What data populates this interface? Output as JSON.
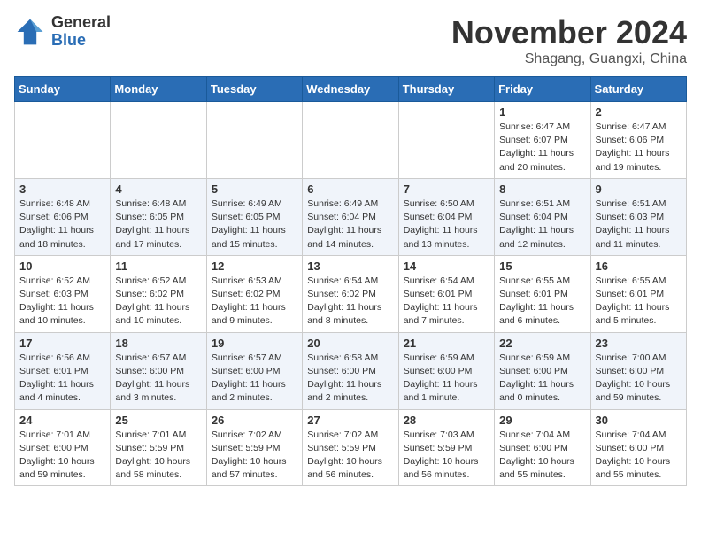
{
  "logo": {
    "general": "General",
    "blue": "Blue"
  },
  "header": {
    "month": "November 2024",
    "location": "Shagang, Guangxi, China"
  },
  "weekdays": [
    "Sunday",
    "Monday",
    "Tuesday",
    "Wednesday",
    "Thursday",
    "Friday",
    "Saturday"
  ],
  "weeks": [
    [
      {
        "day": "",
        "content": ""
      },
      {
        "day": "",
        "content": ""
      },
      {
        "day": "",
        "content": ""
      },
      {
        "day": "",
        "content": ""
      },
      {
        "day": "",
        "content": ""
      },
      {
        "day": "1",
        "content": "Sunrise: 6:47 AM\nSunset: 6:07 PM\nDaylight: 11 hours\nand 20 minutes."
      },
      {
        "day": "2",
        "content": "Sunrise: 6:47 AM\nSunset: 6:06 PM\nDaylight: 11 hours\nand 19 minutes."
      }
    ],
    [
      {
        "day": "3",
        "content": "Sunrise: 6:48 AM\nSunset: 6:06 PM\nDaylight: 11 hours\nand 18 minutes."
      },
      {
        "day": "4",
        "content": "Sunrise: 6:48 AM\nSunset: 6:05 PM\nDaylight: 11 hours\nand 17 minutes."
      },
      {
        "day": "5",
        "content": "Sunrise: 6:49 AM\nSunset: 6:05 PM\nDaylight: 11 hours\nand 15 minutes."
      },
      {
        "day": "6",
        "content": "Sunrise: 6:49 AM\nSunset: 6:04 PM\nDaylight: 11 hours\nand 14 minutes."
      },
      {
        "day": "7",
        "content": "Sunrise: 6:50 AM\nSunset: 6:04 PM\nDaylight: 11 hours\nand 13 minutes."
      },
      {
        "day": "8",
        "content": "Sunrise: 6:51 AM\nSunset: 6:04 PM\nDaylight: 11 hours\nand 12 minutes."
      },
      {
        "day": "9",
        "content": "Sunrise: 6:51 AM\nSunset: 6:03 PM\nDaylight: 11 hours\nand 11 minutes."
      }
    ],
    [
      {
        "day": "10",
        "content": "Sunrise: 6:52 AM\nSunset: 6:03 PM\nDaylight: 11 hours\nand 10 minutes."
      },
      {
        "day": "11",
        "content": "Sunrise: 6:52 AM\nSunset: 6:02 PM\nDaylight: 11 hours\nand 10 minutes."
      },
      {
        "day": "12",
        "content": "Sunrise: 6:53 AM\nSunset: 6:02 PM\nDaylight: 11 hours\nand 9 minutes."
      },
      {
        "day": "13",
        "content": "Sunrise: 6:54 AM\nSunset: 6:02 PM\nDaylight: 11 hours\nand 8 minutes."
      },
      {
        "day": "14",
        "content": "Sunrise: 6:54 AM\nSunset: 6:01 PM\nDaylight: 11 hours\nand 7 minutes."
      },
      {
        "day": "15",
        "content": "Sunrise: 6:55 AM\nSunset: 6:01 PM\nDaylight: 11 hours\nand 6 minutes."
      },
      {
        "day": "16",
        "content": "Sunrise: 6:55 AM\nSunset: 6:01 PM\nDaylight: 11 hours\nand 5 minutes."
      }
    ],
    [
      {
        "day": "17",
        "content": "Sunrise: 6:56 AM\nSunset: 6:01 PM\nDaylight: 11 hours\nand 4 minutes."
      },
      {
        "day": "18",
        "content": "Sunrise: 6:57 AM\nSunset: 6:00 PM\nDaylight: 11 hours\nand 3 minutes."
      },
      {
        "day": "19",
        "content": "Sunrise: 6:57 AM\nSunset: 6:00 PM\nDaylight: 11 hours\nand 2 minutes."
      },
      {
        "day": "20",
        "content": "Sunrise: 6:58 AM\nSunset: 6:00 PM\nDaylight: 11 hours\nand 2 minutes."
      },
      {
        "day": "21",
        "content": "Sunrise: 6:59 AM\nSunset: 6:00 PM\nDaylight: 11 hours\nand 1 minute."
      },
      {
        "day": "22",
        "content": "Sunrise: 6:59 AM\nSunset: 6:00 PM\nDaylight: 11 hours\nand 0 minutes."
      },
      {
        "day": "23",
        "content": "Sunrise: 7:00 AM\nSunset: 6:00 PM\nDaylight: 10 hours\nand 59 minutes."
      }
    ],
    [
      {
        "day": "24",
        "content": "Sunrise: 7:01 AM\nSunset: 6:00 PM\nDaylight: 10 hours\nand 59 minutes."
      },
      {
        "day": "25",
        "content": "Sunrise: 7:01 AM\nSunset: 5:59 PM\nDaylight: 10 hours\nand 58 minutes."
      },
      {
        "day": "26",
        "content": "Sunrise: 7:02 AM\nSunset: 5:59 PM\nDaylight: 10 hours\nand 57 minutes."
      },
      {
        "day": "27",
        "content": "Sunrise: 7:02 AM\nSunset: 5:59 PM\nDaylight: 10 hours\nand 56 minutes."
      },
      {
        "day": "28",
        "content": "Sunrise: 7:03 AM\nSunset: 5:59 PM\nDaylight: 10 hours\nand 56 minutes."
      },
      {
        "day": "29",
        "content": "Sunrise: 7:04 AM\nSunset: 6:00 PM\nDaylight: 10 hours\nand 55 minutes."
      },
      {
        "day": "30",
        "content": "Sunrise: 7:04 AM\nSunset: 6:00 PM\nDaylight: 10 hours\nand 55 minutes."
      }
    ]
  ]
}
